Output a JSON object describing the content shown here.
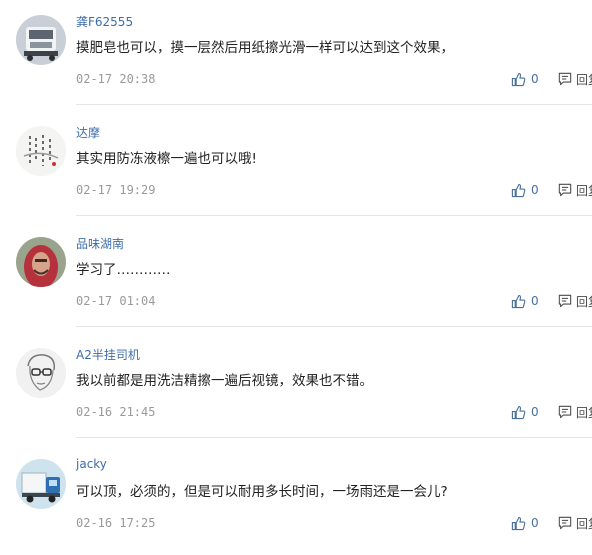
{
  "comments": [
    {
      "username": "龚F62555",
      "text": "摸肥皂也可以，摸一层然后用纸擦光滑一样可以达到这个效果，",
      "time": "02-17 20:38",
      "likes": "0",
      "reply_label": "回复",
      "avatar": "truck-avatar"
    },
    {
      "username": "达摩",
      "text": "其实用防冻液檫一遍也可以哦!",
      "time": "02-17 19:29",
      "likes": "0",
      "reply_label": "回复",
      "avatar": "calligraphy-avatar"
    },
    {
      "username": "品味湖南",
      "text": "学习了…………",
      "time": "02-17 01:04",
      "likes": "0",
      "reply_label": "回复",
      "avatar": "person-red-hood-avatar"
    },
    {
      "username": "A2半挂司机",
      "text": "我以前都是用洗洁精擦一遍后视镜，效果也不错。",
      "time": "02-16 21:45",
      "likes": "0",
      "reply_label": "回复",
      "avatar": "sketch-face-avatar"
    },
    {
      "username": "jacky",
      "text": "可以顶，必须的，但是可以耐用多长时间，一场雨还是一会儿?",
      "time": "02-16 17:25",
      "likes": "0",
      "reply_label": "回复",
      "avatar": "blue-truck-avatar"
    }
  ]
}
